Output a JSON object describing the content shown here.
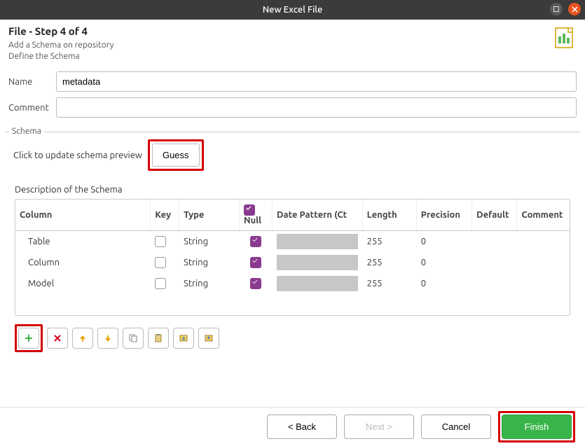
{
  "window": {
    "title": "New Excel File"
  },
  "header": {
    "step_title": "File - Step 4 of 4",
    "subtitle1": "Add a Schema on repository",
    "subtitle2": "Define the Schema"
  },
  "form": {
    "name_label": "Name",
    "name_value": "metadata",
    "comment_label": "Comment",
    "comment_value": ""
  },
  "schema": {
    "legend": "Schema",
    "guess_prompt": "Click to update schema preview",
    "guess_button": "Guess",
    "desc_label": "Description of the Schema",
    "columns": {
      "column": "Column",
      "key": "Key",
      "type": "Type",
      "null": "Null",
      "pattern": "Date Pattern (Ct",
      "length": "Length",
      "precision": "Precision",
      "default": "Default",
      "comment": "Comment"
    },
    "null_header_checked": true,
    "rows": [
      {
        "column": "Table",
        "key": false,
        "type": "String",
        "null": true,
        "length": "255",
        "precision": "0"
      },
      {
        "column": "Column",
        "key": false,
        "type": "String",
        "null": true,
        "length": "255",
        "precision": "0"
      },
      {
        "column": "Model",
        "key": false,
        "type": "String",
        "null": true,
        "length": "255",
        "precision": "0"
      }
    ],
    "toolbar_icons": {
      "add": "plus-icon",
      "remove": "x-icon",
      "up": "arrow-up-icon",
      "down": "arrow-down-icon",
      "copy": "copy-icon",
      "paste": "paste-icon",
      "import": "import-icon",
      "export": "export-icon"
    }
  },
  "footer": {
    "back": "< Back",
    "next": "Next >",
    "cancel": "Cancel",
    "finish": "Finish"
  }
}
